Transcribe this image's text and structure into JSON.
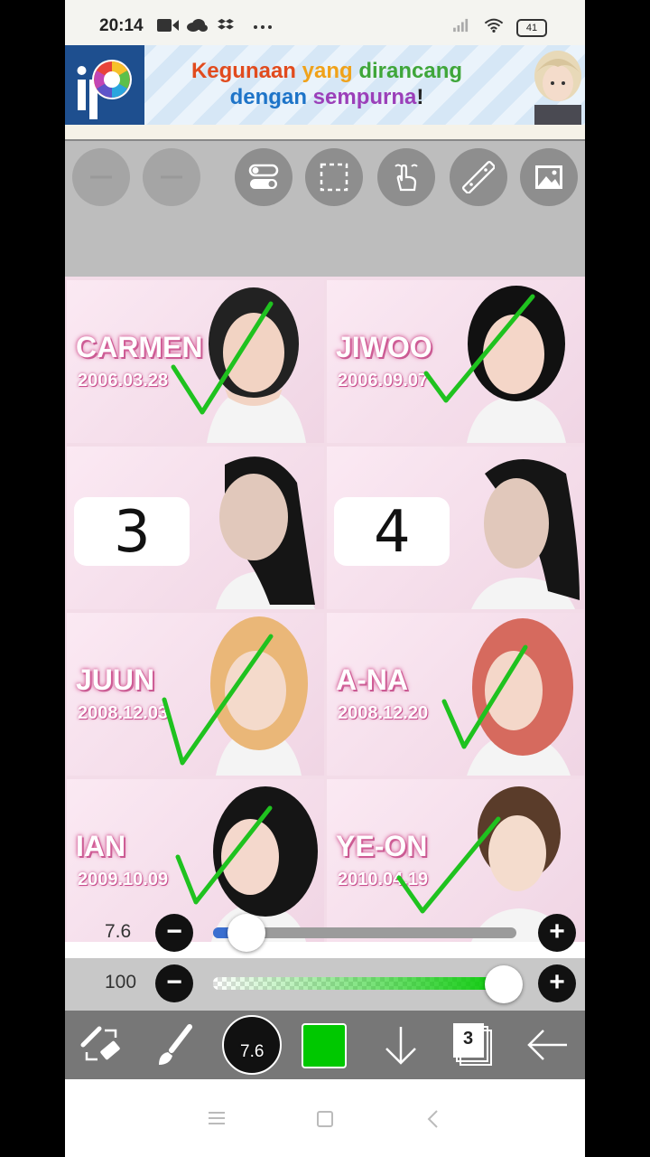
{
  "status_bar": {
    "time": "20:14",
    "battery": "41"
  },
  "ad": {
    "line1_part1": "Kegunaan ",
    "line1_part2": "yang ",
    "line1_part3": "dirancang",
    "line2_part1": "dengan ",
    "line2_part2": "sempurna",
    "line2_part3": "!",
    "colors": {
      "red": "#e14b1e",
      "orange": "#f0a21a",
      "green": "#3fa63a",
      "blue": "#1e74c8",
      "purple": "#9b3fb9"
    }
  },
  "toolbar": {
    "icons": [
      "undo-icon",
      "redo-icon",
      "toggle-icon",
      "selection-icon",
      "hand-icon",
      "ruler-icon",
      "image-icon"
    ]
  },
  "cards": [
    {
      "name": "CARMEN",
      "date": "2006.03.28",
      "checked": true
    },
    {
      "name": "JIWOO",
      "date": "2006.09.07",
      "checked": true
    },
    {
      "number": "3",
      "checked": false
    },
    {
      "number": "4",
      "checked": false
    },
    {
      "name": "JUUN",
      "date": "2008.12.03",
      "checked": true
    },
    {
      "name": "A-NA",
      "date": "2008.12.20",
      "checked": true
    },
    {
      "name": "IAN",
      "date": "2009.10.09",
      "checked": true
    },
    {
      "name": "YE-ON",
      "date": "2010.04.19",
      "checked": true
    }
  ],
  "brush_size": {
    "label": "7.6",
    "minus": "−",
    "plus": "+",
    "value_fraction": 0.08
  },
  "opacity": {
    "label": "100",
    "minus": "−",
    "plus": "+",
    "value": 100
  },
  "bottom_bar": {
    "brush_preview_size": "7.6",
    "color": "#00c800",
    "layer_count": "3"
  },
  "theme": {
    "check_color": "#1fc21f",
    "toolbar_bg": "#bdbdbd",
    "accent_blue": "#3a6fd0"
  }
}
